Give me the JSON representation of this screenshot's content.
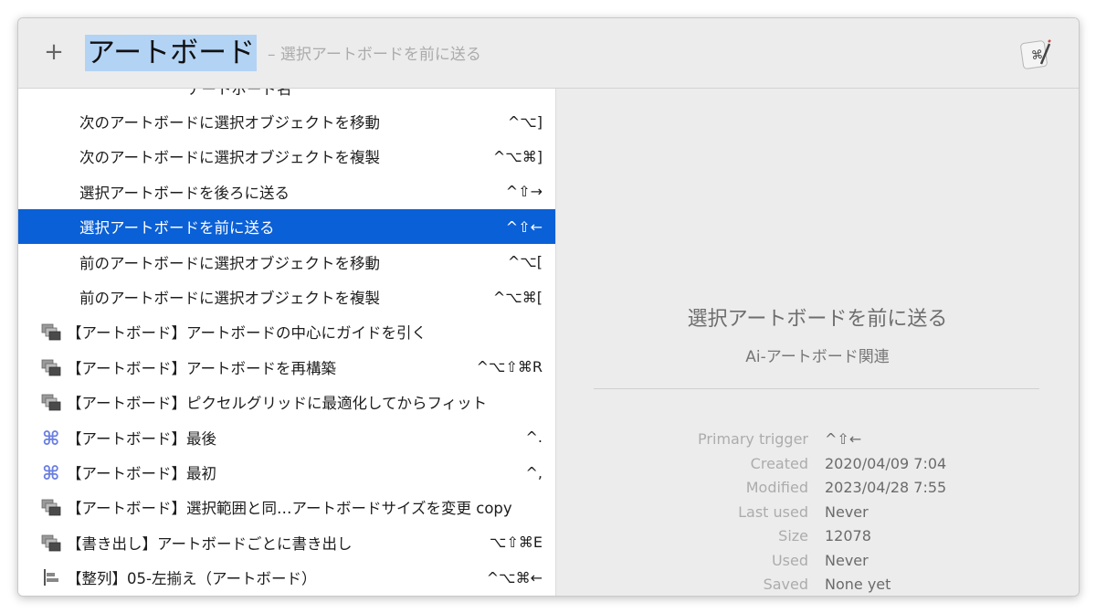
{
  "search": {
    "plus_label": "+",
    "query": "アートボード",
    "hint": "– 選択アートボードを前に送る"
  },
  "results": [
    {
      "label": "アートボード名",
      "shortcut": "",
      "icon": "none",
      "selected": false,
      "partial": true
    },
    {
      "label": "次のアートボードに選択オブジェクトを移動",
      "shortcut": "^⌥]",
      "icon": "none",
      "selected": false
    },
    {
      "label": "次のアートボードに選択オブジェクトを複製",
      "shortcut": "^⌥⌘]",
      "icon": "none",
      "selected": false
    },
    {
      "label": "選択アートボードを後ろに送る",
      "shortcut": "^⇧→",
      "icon": "none",
      "selected": false
    },
    {
      "label": "選択アートボードを前に送る",
      "shortcut": "^⇧←",
      "icon": "none",
      "selected": true
    },
    {
      "label": "前のアートボードに選択オブジェクトを移動",
      "shortcut": "^⌥[",
      "icon": "none",
      "selected": false
    },
    {
      "label": "前のアートボードに選択オブジェクトを複製",
      "shortcut": "^⌥⌘[",
      "icon": "none",
      "selected": false
    },
    {
      "label": "【アートボード】アートボードの中心にガイドを引く",
      "shortcut": "",
      "icon": "windows-icon",
      "selected": false
    },
    {
      "label": "【アートボード】アートボードを再構築",
      "shortcut": "^⌥⇧⌘R",
      "icon": "windows-icon",
      "selected": false
    },
    {
      "label": "【アートボード】ピクセルグリッドに最適化してからフィット",
      "shortcut": "",
      "icon": "windows-icon",
      "selected": false
    },
    {
      "label": "【アートボード】最後",
      "shortcut": "^.",
      "icon": "command-icon",
      "selected": false
    },
    {
      "label": "【アートボード】最初",
      "shortcut": "^,",
      "icon": "command-icon",
      "selected": false
    },
    {
      "label": "【アートボード】選択範囲と同…アートボードサイズを変更 copy",
      "shortcut": "",
      "icon": "windows-icon",
      "selected": false
    },
    {
      "label": "【書き出し】アートボードごとに書き出し",
      "shortcut": "⌥⇧⌘E",
      "icon": "windows-icon",
      "selected": false
    },
    {
      "label": "【整列】05-左揃え（アートボード）",
      "shortcut": "^⌥⌘←",
      "icon": "align-left-icon",
      "selected": false
    }
  ],
  "detail": {
    "title": "選択アートボードを前に送る",
    "group": "Ai-アートボード関連",
    "meta": [
      {
        "label": "Primary trigger",
        "value": "^⇧←"
      },
      {
        "label": "Created",
        "value": "2020/04/09 7:04"
      },
      {
        "label": "Modified",
        "value": "2023/04/28 7:55"
      },
      {
        "label": "Last used",
        "value": "Never"
      },
      {
        "label": "Size",
        "value": "12078"
      },
      {
        "label": "Used",
        "value": "Never"
      },
      {
        "label": "Saved",
        "value": "None yet"
      }
    ]
  },
  "colors": {
    "selection": "#0a60d6",
    "query_highlight": "#b3d3f5",
    "command_icon": "#6b7fe0"
  }
}
